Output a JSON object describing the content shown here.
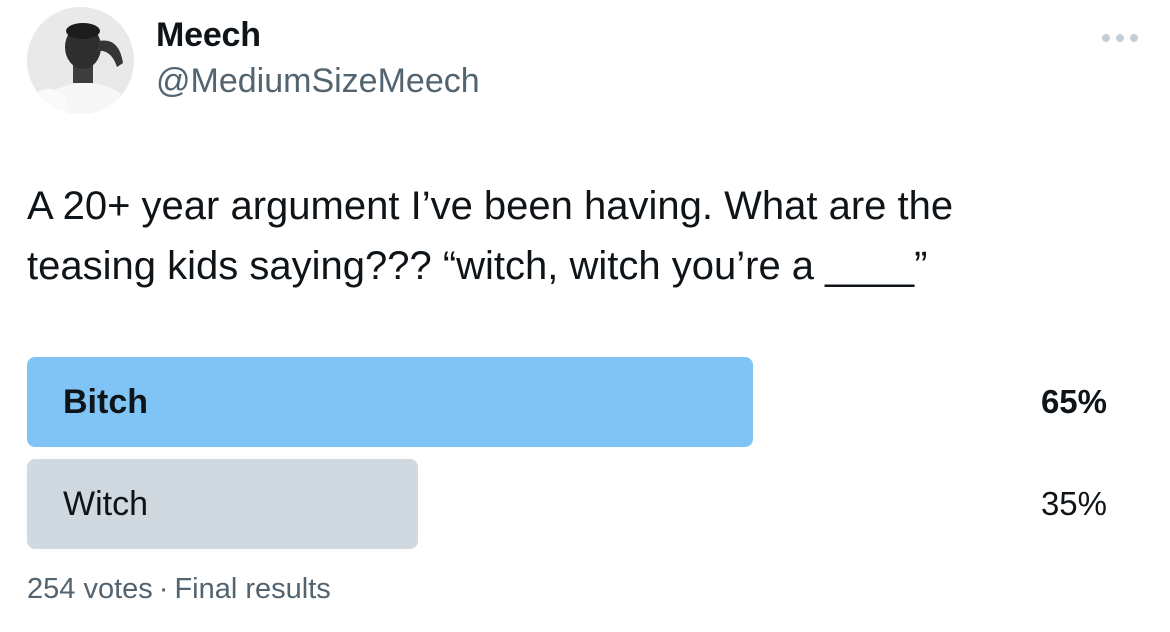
{
  "user": {
    "display_name": "Meech",
    "handle": "@MediumSizeMeech",
    "avatar_icon": "profile-photo"
  },
  "more_icon": "ellipsis-icon",
  "tweet": {
    "line1": "A 20+ year argument I’ve been having. What are the",
    "line2": "teasing kids saying??? “witch, witch you’re a ____”"
  },
  "poll": {
    "options": [
      {
        "label": "Bitch",
        "percent_label": "65%",
        "fraction": 0.65,
        "winner": true,
        "bar_color": "#7fc4f5"
      },
      {
        "label": "Witch",
        "percent_label": "35%",
        "fraction": 0.35,
        "winner": false,
        "bar_color": "#d0d9e0"
      }
    ],
    "votes": "254 votes",
    "separator": "·",
    "status": "Final results"
  }
}
